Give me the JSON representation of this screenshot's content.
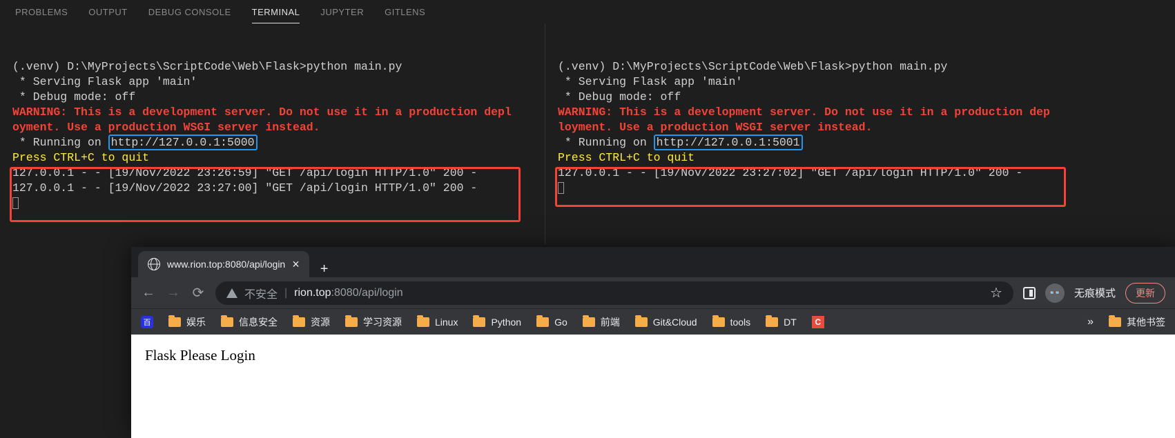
{
  "panel_tabs": {
    "problems": "PROBLEMS",
    "output": "OUTPUT",
    "debug_console": "DEBUG CONSOLE",
    "terminal": "TERMINAL",
    "jupyter": "JUPYTER",
    "gitlens": "GITLENS"
  },
  "term_left": {
    "prompt": "(.venv) D:\\MyProjects\\ScriptCode\\Web\\Flask>python main.py",
    "serving": " * Serving Flask app 'main'",
    "debug": " * Debug mode: off",
    "warn1": "WARNING: This is a development server. Do not use it in a production depl",
    "warn2": "oyment. Use a production WSGI server instead.",
    "running_prefix": " * Running on ",
    "url": "http://127.0.0.1:5000",
    "press": "Press CTRL+C to quit",
    "log1": "127.0.0.1 - - [19/Nov/2022 23:26:59] \"GET /api/login HTTP/1.0\" 200 -",
    "log2": "127.0.0.1 - - [19/Nov/2022 23:27:00] \"GET /api/login HTTP/1.0\" 200 -"
  },
  "term_right": {
    "prompt": "(.venv) D:\\MyProjects\\ScriptCode\\Web\\Flask>python main.py",
    "serving": " * Serving Flask app 'main'",
    "debug": " * Debug mode: off",
    "warn1": "WARNING: This is a development server. Do not use it in a production dep",
    "warn2": "loyment. Use a production WSGI server instead.",
    "running_prefix": " * Running on ",
    "url": "http://127.0.0.1:5001",
    "press": "Press CTRL+C to quit",
    "log1": "127.0.0.1 - - [19/Nov/2022 23:27:02] \"GET /api/login HTTP/1.0\" 200 -"
  },
  "browser": {
    "tab_title": "www.rion.top:8080/api/login",
    "insecure_label": "不安全",
    "url_host": "rion.top",
    "url_rest": ":8080/api/login",
    "incognito_label": "无痕模式",
    "update_label": "更新",
    "bookmarks": {
      "b1": "娱乐",
      "b2": "信息安全",
      "b3": "资源",
      "b4": "学习资源",
      "b5": "Linux",
      "b6": "Python",
      "b7": "Go",
      "b8": "前端",
      "b9": "Git&Cloud",
      "b10": "tools",
      "b11": "DT",
      "b12": "其他书签"
    },
    "page_text": "Flask Please Login"
  }
}
